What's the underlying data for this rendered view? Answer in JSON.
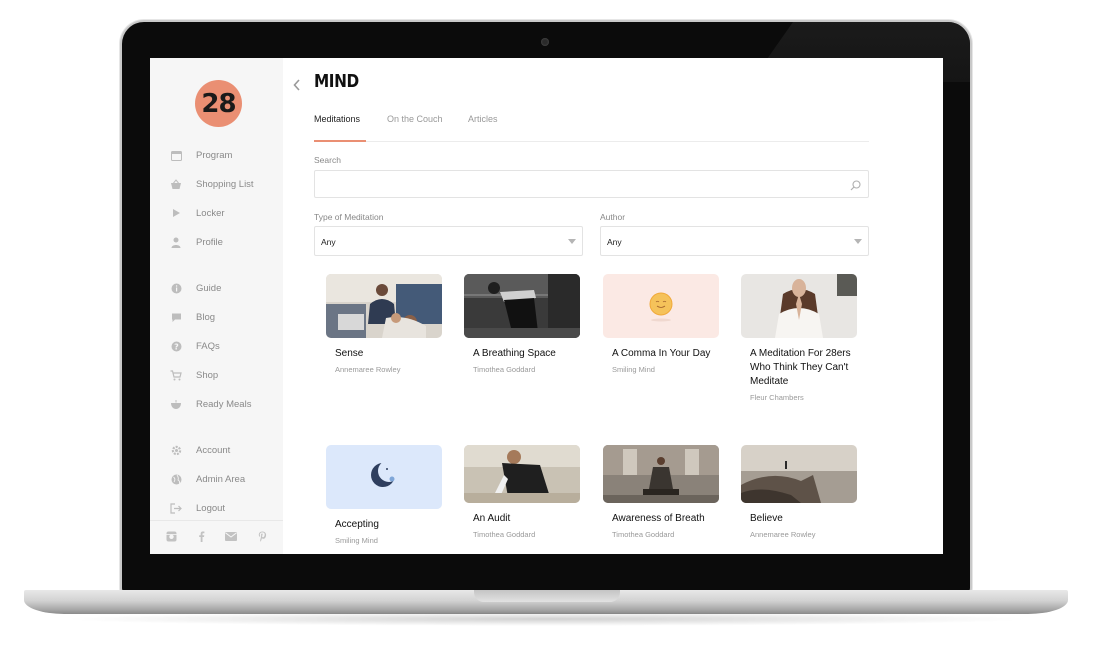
{
  "sidebar": {
    "logo": "28",
    "nav": [
      {
        "label": "Program",
        "icon": "calendar-icon"
      },
      {
        "label": "Shopping List",
        "icon": "basket-icon"
      },
      {
        "label": "Locker",
        "icon": "play-icon"
      },
      {
        "label": "Profile",
        "icon": "user-icon"
      }
    ],
    "nav_secondary": [
      {
        "label": "Guide",
        "icon": "info-icon"
      },
      {
        "label": "Blog",
        "icon": "chat-bubble-icon"
      },
      {
        "label": "FAQs",
        "icon": "question-icon"
      },
      {
        "label": "Shop",
        "icon": "cart-icon"
      },
      {
        "label": "Ready Meals",
        "icon": "bowl-icon"
      }
    ],
    "nav_account": [
      {
        "label": "Account",
        "icon": "gear-icon"
      },
      {
        "label": "Admin Area",
        "icon": "globe-icon"
      },
      {
        "label": "Logout",
        "icon": "logout-icon"
      }
    ],
    "social": [
      "instagram-icon",
      "facebook-icon",
      "mail-icon",
      "pinterest-icon"
    ]
  },
  "page": {
    "title": "MIND",
    "tabs": [
      {
        "label": "Meditations",
        "active": true
      },
      {
        "label": "On the Couch",
        "active": false
      },
      {
        "label": "Articles",
        "active": false
      }
    ]
  },
  "filters": {
    "search_label": "Search",
    "search_value": "",
    "type_label": "Type of Meditation",
    "type_value": "Any",
    "author_label": "Author",
    "author_value": "Any"
  },
  "cards": [
    {
      "title": "Sense",
      "author": "Annemaree Rowley",
      "thumb": "photo-people-couch"
    },
    {
      "title": "A Breathing Space",
      "author": "Timothea Goddard",
      "thumb": "photo-man-stretching"
    },
    {
      "title": "A Comma In Your Day",
      "author": "Smiling Mind",
      "thumb": "smiley-sun-illustration"
    },
    {
      "title": "A Meditation For 28ers Who Think They Can't Meditate",
      "author": "Fleur Chambers",
      "thumb": "photo-woman-praying"
    },
    {
      "title": "Accepting",
      "author": "Smiling Mind",
      "thumb": "moon-illustration"
    },
    {
      "title": "An Audit",
      "author": "Timothea Goddard",
      "thumb": "photo-man-pushup"
    },
    {
      "title": "Awareness of Breath",
      "author": "Timothea Goddard",
      "thumb": "photo-woman-sitting"
    },
    {
      "title": "Believe",
      "author": "Annemaree Rowley",
      "thumb": "photo-cliff-landscape"
    }
  ],
  "colors": {
    "accent": "#ea8f73",
    "sidebar_bg": "#f6f6f6"
  }
}
